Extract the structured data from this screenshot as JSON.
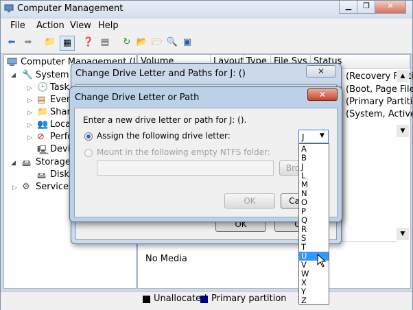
{
  "window": {
    "title": "Computer Management",
    "menu": [
      "File",
      "Action",
      "View",
      "Help"
    ]
  },
  "tree": {
    "root": "Computer Management (Local",
    "system_tools": "System To",
    "task_scheduler": "Task S",
    "event_viewer": "Event",
    "shared_folders": "Shared",
    "local_users": "Local",
    "performance": "Perfor",
    "device_manager": "Device",
    "storage": "Storage",
    "disk_management": "Disk M",
    "services": "Services a"
  },
  "volume_table": {
    "columns": [
      "Volume",
      "Layout",
      "Type",
      "File Sys",
      "Status"
    ],
    "status_cells": [
      "(Recovery Partitio",
      "(Boot, Page File, (",
      "(Primary Partitio",
      "(System, Active, P"
    ]
  },
  "disk_area": {
    "no_media": "No Media"
  },
  "legend": {
    "unallocated": "Unallocated",
    "primary": "Primary partition",
    "unallocated_color": "#000000",
    "primary_color": "#000080"
  },
  "dialog_paths": {
    "title": "Change Drive Letter and Paths for J: ()",
    "ok": "OK",
    "cancel": "Ca"
  },
  "dialog_letter": {
    "title": "Change Drive Letter or Path",
    "prompt": "Enter a new drive letter or path for J: ().",
    "assign_label": "Assign the following drive letter:",
    "mount_label": "Mount in the following empty NTFS folder:",
    "browse": "Bro",
    "ok": "OK",
    "cancel": "Ca",
    "selected_letter": "J",
    "letters": [
      "A",
      "B",
      "J",
      "L",
      "M",
      "N",
      "O",
      "P",
      "Q",
      "R",
      "S",
      "T",
      "U",
      "V",
      "W",
      "X",
      "Y",
      "Z"
    ],
    "highlighted": "U"
  }
}
